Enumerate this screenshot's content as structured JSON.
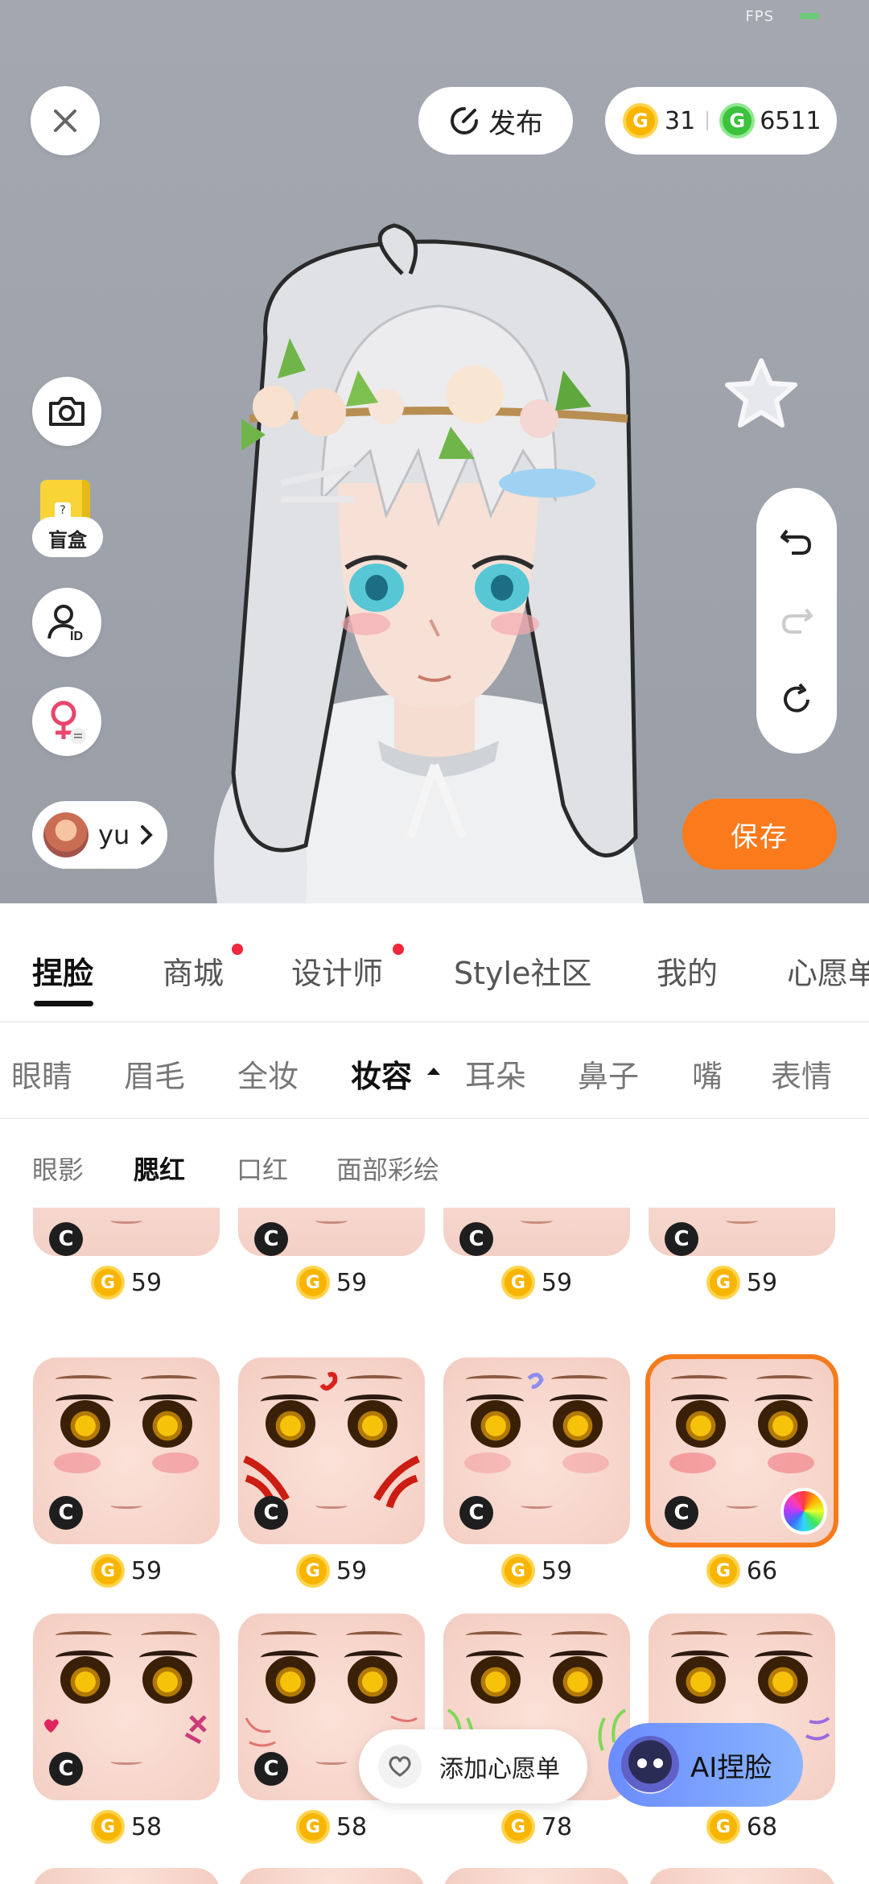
{
  "status": {
    "fps_label": "FPS"
  },
  "top_bar": {
    "publish_label": "发布",
    "currency": {
      "gold_amount": "31",
      "green_amount": "6511"
    }
  },
  "left_tools": {
    "blindbox_label": "盲盒",
    "user_name": "yu"
  },
  "actions": {
    "save_label": "保存"
  },
  "main_tabs": [
    {
      "label": "捏脸",
      "active": true
    },
    {
      "label": "商城",
      "badge": true
    },
    {
      "label": "设计师",
      "badge": true
    },
    {
      "label": "Style社区"
    },
    {
      "label": "我的"
    },
    {
      "label": "心愿单"
    }
  ],
  "category_tabs": [
    {
      "label": "眼睛"
    },
    {
      "label": "眉毛"
    },
    {
      "label": "全妆"
    },
    {
      "label": "妆容",
      "active": true,
      "expanded": true
    },
    {
      "label": "耳朵"
    },
    {
      "label": "鼻子"
    },
    {
      "label": "嘴"
    },
    {
      "label": "表情"
    }
  ],
  "makeup_tabs": [
    {
      "label": "眼影"
    },
    {
      "label": "腮红",
      "active": true
    },
    {
      "label": "口红"
    },
    {
      "label": "面部彩绘"
    }
  ],
  "items": {
    "row0": [
      {
        "price": "59"
      },
      {
        "price": "59"
      },
      {
        "price": "59"
      },
      {
        "price": "59"
      }
    ],
    "row1": [
      {
        "price": "59"
      },
      {
        "price": "59"
      },
      {
        "price": "59"
      },
      {
        "price": "66",
        "selected": true
      }
    ],
    "row2": [
      {
        "price": "58"
      },
      {
        "price": "58"
      },
      {
        "price": "78"
      },
      {
        "price": "68"
      }
    ],
    "badge_letter": "C",
    "coin_letter": "G"
  },
  "floating": {
    "wishlist_label": "添加心愿单",
    "ai_label": "AI捏脸"
  },
  "colors": {
    "accent": "#fb7a1c",
    "selected_outline": "#f57b1c",
    "badge_red": "#f0273d"
  }
}
